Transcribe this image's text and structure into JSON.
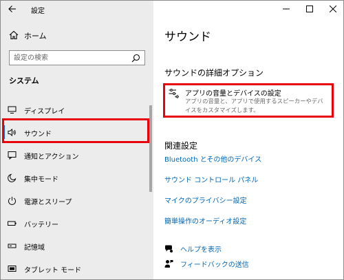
{
  "window": {
    "title": "設定"
  },
  "sidebar": {
    "home_label": "ホーム",
    "search_placeholder": "設定の検索",
    "section_heading": "システム",
    "items": [
      {
        "label": "ディスプレイ",
        "icon": "monitor-icon"
      },
      {
        "label": "サウンド",
        "icon": "speaker-icon",
        "selected": true
      },
      {
        "label": "通知とアクション",
        "icon": "notification-icon"
      },
      {
        "label": "集中モード",
        "icon": "moon-icon"
      },
      {
        "label": "電源とスリープ",
        "icon": "power-icon"
      },
      {
        "label": "バッテリー",
        "icon": "battery-icon"
      },
      {
        "label": "記憶域",
        "icon": "storage-icon"
      },
      {
        "label": "タブレット モード",
        "icon": "tablet-icon"
      }
    ]
  },
  "main": {
    "title": "サウンド",
    "advanced_heading": "サウンドの詳細オプション",
    "app_volume": {
      "title": "アプリの音量とデバイスの設定",
      "description": "アプリの音量と、アプリで使用するスピーカーやデバイスをカスタマイズします。"
    },
    "related_heading": "関連設定",
    "related_links": [
      "Bluetooth とその他のデバイス",
      "サウンド コントロール パネル",
      "マイクのプライバシー設定",
      "簡単操作のオーディオ設定"
    ],
    "help_label": "ヘルプを表示",
    "feedback_label": "フィードバックの送信"
  },
  "colors": {
    "accent": "#0078d7",
    "link": "#0066b4",
    "highlight": "#e8000b",
    "sidebar_bg": "#ececec"
  }
}
